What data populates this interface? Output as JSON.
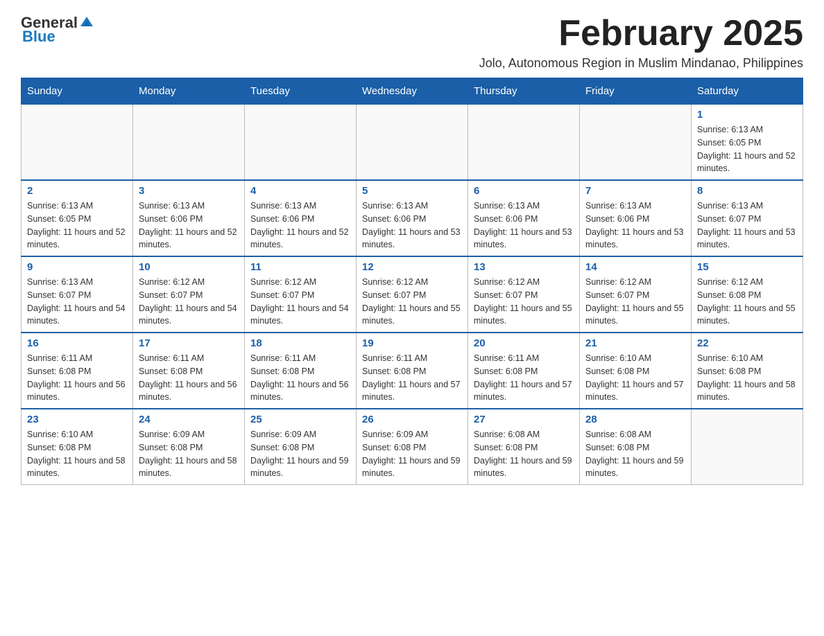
{
  "logo": {
    "general": "General",
    "blue": "Blue"
  },
  "title": "February 2025",
  "subtitle": "Jolo, Autonomous Region in Muslim Mindanao, Philippines",
  "days_of_week": [
    "Sunday",
    "Monday",
    "Tuesday",
    "Wednesday",
    "Thursday",
    "Friday",
    "Saturday"
  ],
  "weeks": [
    [
      {
        "day": "",
        "sunrise": "",
        "sunset": "",
        "daylight": ""
      },
      {
        "day": "",
        "sunrise": "",
        "sunset": "",
        "daylight": ""
      },
      {
        "day": "",
        "sunrise": "",
        "sunset": "",
        "daylight": ""
      },
      {
        "day": "",
        "sunrise": "",
        "sunset": "",
        "daylight": ""
      },
      {
        "day": "",
        "sunrise": "",
        "sunset": "",
        "daylight": ""
      },
      {
        "day": "",
        "sunrise": "",
        "sunset": "",
        "daylight": ""
      },
      {
        "day": "1",
        "sunrise": "Sunrise: 6:13 AM",
        "sunset": "Sunset: 6:05 PM",
        "daylight": "Daylight: 11 hours and 52 minutes."
      }
    ],
    [
      {
        "day": "2",
        "sunrise": "Sunrise: 6:13 AM",
        "sunset": "Sunset: 6:05 PM",
        "daylight": "Daylight: 11 hours and 52 minutes."
      },
      {
        "day": "3",
        "sunrise": "Sunrise: 6:13 AM",
        "sunset": "Sunset: 6:06 PM",
        "daylight": "Daylight: 11 hours and 52 minutes."
      },
      {
        "day": "4",
        "sunrise": "Sunrise: 6:13 AM",
        "sunset": "Sunset: 6:06 PM",
        "daylight": "Daylight: 11 hours and 52 minutes."
      },
      {
        "day": "5",
        "sunrise": "Sunrise: 6:13 AM",
        "sunset": "Sunset: 6:06 PM",
        "daylight": "Daylight: 11 hours and 53 minutes."
      },
      {
        "day": "6",
        "sunrise": "Sunrise: 6:13 AM",
        "sunset": "Sunset: 6:06 PM",
        "daylight": "Daylight: 11 hours and 53 minutes."
      },
      {
        "day": "7",
        "sunrise": "Sunrise: 6:13 AM",
        "sunset": "Sunset: 6:06 PM",
        "daylight": "Daylight: 11 hours and 53 minutes."
      },
      {
        "day": "8",
        "sunrise": "Sunrise: 6:13 AM",
        "sunset": "Sunset: 6:07 PM",
        "daylight": "Daylight: 11 hours and 53 minutes."
      }
    ],
    [
      {
        "day": "9",
        "sunrise": "Sunrise: 6:13 AM",
        "sunset": "Sunset: 6:07 PM",
        "daylight": "Daylight: 11 hours and 54 minutes."
      },
      {
        "day": "10",
        "sunrise": "Sunrise: 6:12 AM",
        "sunset": "Sunset: 6:07 PM",
        "daylight": "Daylight: 11 hours and 54 minutes."
      },
      {
        "day": "11",
        "sunrise": "Sunrise: 6:12 AM",
        "sunset": "Sunset: 6:07 PM",
        "daylight": "Daylight: 11 hours and 54 minutes."
      },
      {
        "day": "12",
        "sunrise": "Sunrise: 6:12 AM",
        "sunset": "Sunset: 6:07 PM",
        "daylight": "Daylight: 11 hours and 55 minutes."
      },
      {
        "day": "13",
        "sunrise": "Sunrise: 6:12 AM",
        "sunset": "Sunset: 6:07 PM",
        "daylight": "Daylight: 11 hours and 55 minutes."
      },
      {
        "day": "14",
        "sunrise": "Sunrise: 6:12 AM",
        "sunset": "Sunset: 6:07 PM",
        "daylight": "Daylight: 11 hours and 55 minutes."
      },
      {
        "day": "15",
        "sunrise": "Sunrise: 6:12 AM",
        "sunset": "Sunset: 6:08 PM",
        "daylight": "Daylight: 11 hours and 55 minutes."
      }
    ],
    [
      {
        "day": "16",
        "sunrise": "Sunrise: 6:11 AM",
        "sunset": "Sunset: 6:08 PM",
        "daylight": "Daylight: 11 hours and 56 minutes."
      },
      {
        "day": "17",
        "sunrise": "Sunrise: 6:11 AM",
        "sunset": "Sunset: 6:08 PM",
        "daylight": "Daylight: 11 hours and 56 minutes."
      },
      {
        "day": "18",
        "sunrise": "Sunrise: 6:11 AM",
        "sunset": "Sunset: 6:08 PM",
        "daylight": "Daylight: 11 hours and 56 minutes."
      },
      {
        "day": "19",
        "sunrise": "Sunrise: 6:11 AM",
        "sunset": "Sunset: 6:08 PM",
        "daylight": "Daylight: 11 hours and 57 minutes."
      },
      {
        "day": "20",
        "sunrise": "Sunrise: 6:11 AM",
        "sunset": "Sunset: 6:08 PM",
        "daylight": "Daylight: 11 hours and 57 minutes."
      },
      {
        "day": "21",
        "sunrise": "Sunrise: 6:10 AM",
        "sunset": "Sunset: 6:08 PM",
        "daylight": "Daylight: 11 hours and 57 minutes."
      },
      {
        "day": "22",
        "sunrise": "Sunrise: 6:10 AM",
        "sunset": "Sunset: 6:08 PM",
        "daylight": "Daylight: 11 hours and 58 minutes."
      }
    ],
    [
      {
        "day": "23",
        "sunrise": "Sunrise: 6:10 AM",
        "sunset": "Sunset: 6:08 PM",
        "daylight": "Daylight: 11 hours and 58 minutes."
      },
      {
        "day": "24",
        "sunrise": "Sunrise: 6:09 AM",
        "sunset": "Sunset: 6:08 PM",
        "daylight": "Daylight: 11 hours and 58 minutes."
      },
      {
        "day": "25",
        "sunrise": "Sunrise: 6:09 AM",
        "sunset": "Sunset: 6:08 PM",
        "daylight": "Daylight: 11 hours and 59 minutes."
      },
      {
        "day": "26",
        "sunrise": "Sunrise: 6:09 AM",
        "sunset": "Sunset: 6:08 PM",
        "daylight": "Daylight: 11 hours and 59 minutes."
      },
      {
        "day": "27",
        "sunrise": "Sunrise: 6:08 AM",
        "sunset": "Sunset: 6:08 PM",
        "daylight": "Daylight: 11 hours and 59 minutes."
      },
      {
        "day": "28",
        "sunrise": "Sunrise: 6:08 AM",
        "sunset": "Sunset: 6:08 PM",
        "daylight": "Daylight: 11 hours and 59 minutes."
      },
      {
        "day": "",
        "sunrise": "",
        "sunset": "",
        "daylight": ""
      }
    ]
  ]
}
